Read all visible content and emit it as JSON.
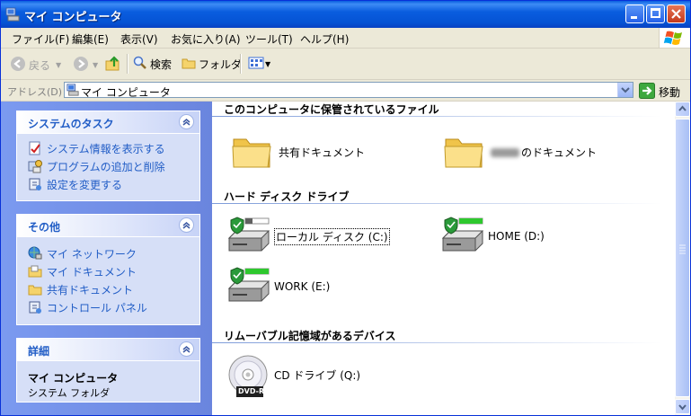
{
  "window": {
    "title": "マイ コンピュータ"
  },
  "menu": {
    "items": [
      "ファイル(F)",
      "編集(E)",
      "表示(V)",
      "お気に入り(A)",
      "ツール(T)",
      "ヘルプ(H)"
    ]
  },
  "toolbar": {
    "back_label": "戻る",
    "search_label": "検索",
    "folders_label": "フォルダ"
  },
  "address": {
    "label": "アドレス(D)",
    "value": "マイ コンピュータ",
    "go_label": "移動"
  },
  "left_pane": {
    "system_tasks": {
      "title": "システムのタスク",
      "items": [
        "システム情報を表示する",
        "プログラムの追加と削除",
        "設定を変更する"
      ]
    },
    "other_places": {
      "title": "その他",
      "items": [
        "マイ ネットワーク",
        "マイ ドキュメント",
        "共有ドキュメント",
        "コントロール パネル"
      ]
    },
    "details": {
      "title": "詳細",
      "name": "マイ コンピュータ",
      "type": "システム フォルダ"
    }
  },
  "content": {
    "stored_files": {
      "title": "このコンピュータに保管されているファイル",
      "shared_docs": "共有ドキュメント",
      "user_docs_suffix": "のドキュメント"
    },
    "hard_drives": {
      "title": "ハード ディスク ドライブ",
      "drives": [
        {
          "label": "ローカル ディスク (C:)",
          "used_fraction": 0.3
        },
        {
          "label": "HOME (D:)",
          "used_fraction": 1.0
        },
        {
          "label": "WORK (E:)",
          "used_fraction": 1.0
        }
      ]
    },
    "removable": {
      "title": "リムーバブル記憶域があるデバイス",
      "cd_label": "CD ドライブ (Q:)",
      "disc_badge": "DVD-R"
    }
  },
  "colors": {
    "titlebar": "#0a5ddf",
    "link": "#215dc6",
    "drive_free": "#2ec82e"
  }
}
